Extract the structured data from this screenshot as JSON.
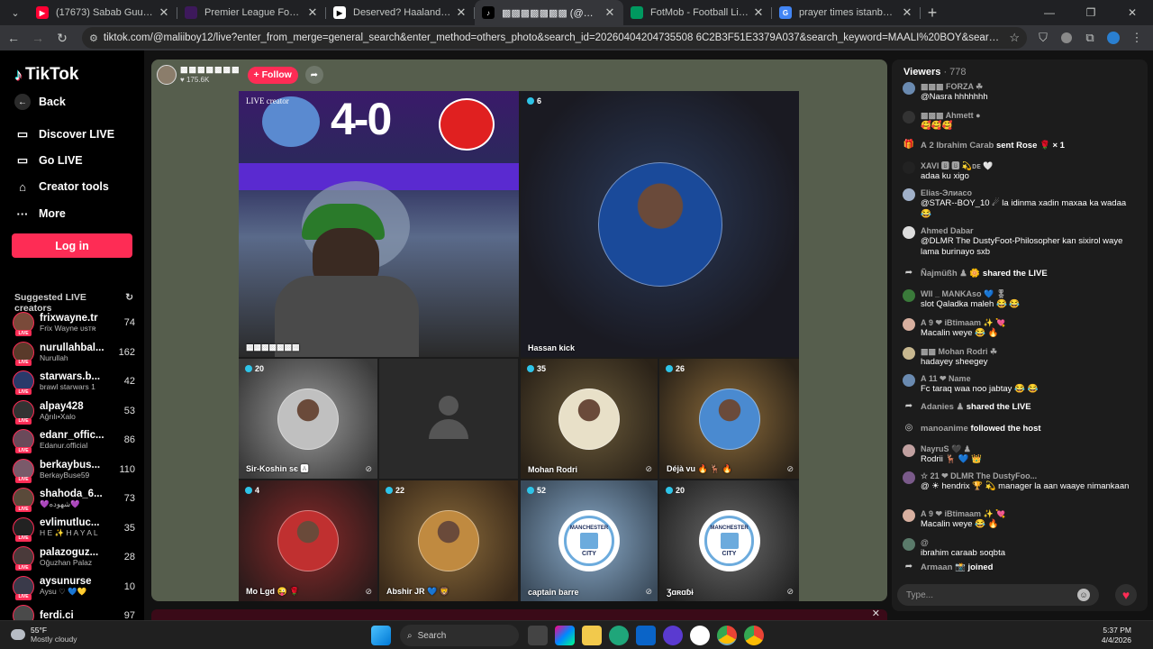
{
  "browser": {
    "tabs": [
      {
        "title": "(17673) Sabab Guuldaradii City",
        "fav_color": "#ff0033",
        "fav_glyph": "▶",
        "active": false
      },
      {
        "title": "Premier League Football News,",
        "fav_color": "#3d195b",
        "fav_glyph": "",
        "active": false
      },
      {
        "title": "Deserved? Haaland wins UEFA",
        "fav_color": "#ffffff",
        "fav_glyph": "▶",
        "active": false
      },
      {
        "title": "▩▩▩▩▩▩▩ (@maliiboy1",
        "fav_color": "#000000",
        "fav_glyph": "♪",
        "active": true
      },
      {
        "title": "FotMob - Football Live Scores",
        "fav_color": "#00985f",
        "fav_glyph": "",
        "active": false
      },
      {
        "title": "prayer times istanbul - Google",
        "fav_color": "#4285f4",
        "fav_glyph": "G",
        "active": false
      }
    ],
    "url": "tiktok.com/@maliiboy12/live?enter_from_merge=general_search&enter_method=others_photo&search_id=20260404204735508 6C2B3F51E3379A037&search_keyword=MAALI%20BOY&search_result_id=6727586638124024838&search_type=..."
  },
  "sidebar": {
    "logo": "TikTok",
    "back": "Back",
    "nav": [
      {
        "label": "Discover LIVE",
        "icon": "broadcast-icon"
      },
      {
        "label": "Go LIVE",
        "icon": "camera-icon"
      },
      {
        "label": "Creator tools",
        "icon": "lightbulb-icon"
      },
      {
        "label": "More",
        "icon": "more-dots-icon"
      }
    ],
    "login": "Log in",
    "suggested_title": "Suggested LIVE creators",
    "live_tag": "LIVE",
    "creators": [
      {
        "name": "frixwayne.tr",
        "sub": "Frix Wayne ᴜѕᴛʀ",
        "count": "74",
        "color": "#7a4a3a"
      },
      {
        "name": "nurullahbal...",
        "sub": "Nurullah",
        "count": "162",
        "color": "#5a3a2a"
      },
      {
        "name": "starwars.b...",
        "sub": "brawl starwars 1",
        "count": "42",
        "color": "#2a3a6a"
      },
      {
        "name": "alpay428",
        "sub": "Ağrılı•Xalo",
        "count": "53",
        "color": "#333"
      },
      {
        "name": "edanr_offic...",
        "sub": "Edanur.official",
        "count": "86",
        "color": "#6a4a5a"
      },
      {
        "name": "berkaybus...",
        "sub": "BerkayBuse59",
        "count": "110",
        "color": "#7a5a6a"
      },
      {
        "name": "shahoda_6...",
        "sub": "💜شهوده💜",
        "count": "73",
        "color": "#5a4a3a"
      },
      {
        "name": "evlimutluc...",
        "sub": "H E ✨ H A Y A L",
        "count": "35",
        "color": "#222"
      },
      {
        "name": "palazoguz...",
        "sub": "Oğuzhan Palaz",
        "count": "28",
        "color": "#4a3a3a"
      },
      {
        "name": "aysunurse",
        "sub": "Aysu ♡ 💙💛",
        "count": "10",
        "color": "#3a3a4a"
      },
      {
        "name": "ferdi.ci",
        "sub": "",
        "count": "97",
        "color": "#4a4a4a"
      }
    ]
  },
  "stream": {
    "host_name": "▩▩▩▩▩▩▩",
    "host_likes": "♥ 175.6K",
    "follow": "+ Follow",
    "main_tag": "LIVE creator",
    "main_score": "4-0",
    "main_label": "▩▩▩▩▩▩▩",
    "guests": [
      {
        "name": "Hassan kick",
        "count": "6"
      },
      {
        "name": "Sir-Koshin ѕє 🅰",
        "count": "20"
      },
      {
        "name": "",
        "count": ""
      },
      {
        "name": "Mohan Rodri",
        "count": "35"
      },
      {
        "name": "Déjà vu 🔥 🦌 🔥",
        "count": "26"
      },
      {
        "name": "Mo Lgd 😜 🌹",
        "count": "4"
      },
      {
        "name": "Abshir JR 💙 🦁",
        "count": "22"
      },
      {
        "name": "captain barre",
        "count": "52"
      },
      {
        "name": "Ʒɑʀɑɓɨ",
        "count": "20"
      }
    ],
    "mc_text_top": "MANCHESTER",
    "mc_text_bottom": "CITY"
  },
  "chat": {
    "viewers_label": "Viewers",
    "viewers_count": "· 778",
    "messages": [
      {
        "type": "msg",
        "name": "▩▩▩ FORZA ☘",
        "text": "@Nasra hhhhhhh",
        "color": "#6a8ab0"
      },
      {
        "type": "msg",
        "name": "▩▩▩ Ahmett ●",
        "text": "🥰🥰🥰",
        "color": "#333"
      },
      {
        "type": "sys",
        "icon": "🎁",
        "name": "А 2  Ibrahim Carab",
        "text": "sent Rose 🌹 × 1"
      },
      {
        "type": "msg",
        "name": "XAVI 🅱 🅱 💫ᴅᴇ 🤍",
        "text": "adaa ku xigo",
        "color": "#222"
      },
      {
        "type": "msg",
        "name": "Elias-Элиасо",
        "text": "@STAR--BOY_10 ☄ la idinma xadin maxaa ka wadaa 😂",
        "color": "#a0b0c8"
      },
      {
        "type": "msg",
        "name": "Ahmed Dabar",
        "text": "@DLMR The DustyFoot-Philosopher kan sixirol waye lama burinayo sxb",
        "color": "#ddd"
      },
      {
        "type": "sys",
        "icon": "➦",
        "name": "Ñajmüßh ♟ 🌼",
        "text": "shared the LIVE"
      },
      {
        "type": "msg",
        "name": "Wll _ MANKAso 💙 🎖",
        "text": "slot Qaladka maleh 😂 😂",
        "color": "#3a7a3a"
      },
      {
        "type": "msg",
        "name": "А 9 ❤ iBtimaam ✨ 💘",
        "text": "Macalin weye 😂 🔥",
        "color": "#d8b0a0"
      },
      {
        "type": "msg",
        "name": "▩▩ Mohan Rodri ☘",
        "text": "hadayey sheegey",
        "color": "#c8b890"
      },
      {
        "type": "msg",
        "name": "А 11 ❤ Name",
        "text": "Fc taraq waa noo jabtay 😂 😂",
        "color": "#6a8ab0"
      },
      {
        "type": "sys",
        "icon": "➦",
        "name": "Adanies ♟",
        "text": "shared the LIVE"
      },
      {
        "type": "sys",
        "icon": "◎",
        "name": "manoanime",
        "text": "followed the host"
      },
      {
        "type": "msg",
        "name": "NayruS 🖤 ♟",
        "text": "Rodrii 🦌 💙 👑",
        "color": "#c0a0a0"
      },
      {
        "type": "msg",
        "name": "☆ 21 ❤ DLMR The DustyFoo...",
        "text": "@ ☀ hendrix 🏆 💫 manager la aan waaye nimankaan",
        "color": "#7a5a8a"
      },
      {
        "type": "msg",
        "name": "А 9 ❤ iBtimaam ✨ 💘",
        "text": "Macalin weye 😂 🔥",
        "color": "#d8b0a0"
      },
      {
        "type": "msg",
        "name": "@",
        "text": "ibrahim caraab soqbta",
        "color": "#5a7a6a"
      },
      {
        "type": "sys",
        "icon": "➦",
        "name": "Armaan 📸",
        "text": "joined"
      }
    ],
    "input_placeholder": "Type...",
    "heart": "♥"
  },
  "taskbar": {
    "temp": "55°F",
    "weather": "Mostly cloudy",
    "search": "Search",
    "time": "5:37 PM",
    "date": "4/4/2026"
  }
}
